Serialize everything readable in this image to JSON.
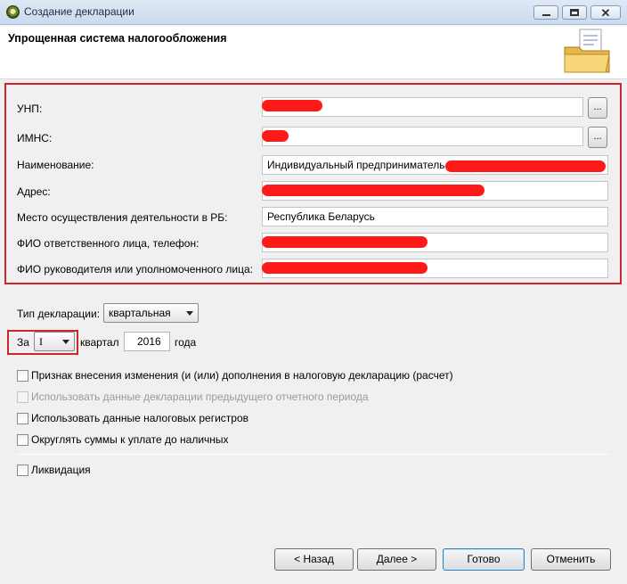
{
  "window": {
    "title": "Создание декларации"
  },
  "header": {
    "title": "Упрощенная система налогообложения"
  },
  "form": {
    "unp_label": "УНП:",
    "imns_label": "ИМНС:",
    "name_label": "Наименование:",
    "name_value": "Индивидуальный предприниматель",
    "address_label": "Адрес:",
    "place_label": "Место осуществления деятельности в РБ:",
    "place_value": "Республика Беларусь",
    "responsible_label": "ФИО ответственного лица, телефон:",
    "head_label": "ФИО руководителя или уполномоченного лица:",
    "browse_label": "..."
  },
  "declaration": {
    "type_label": "Тип декларации:",
    "type_value": "квартальная",
    "for_label": "За",
    "quarter_value": "I",
    "quarter_label": "квартал",
    "year_value": "2016",
    "year_label": "года"
  },
  "options": {
    "change_flag": "Признак внесения изменения (и (или) дополнения в налоговую декларацию (расчет)",
    "use_previous": "Использовать данные декларации предыдущего отчетного периода",
    "use_registers": "Использовать данные налоговых регистров",
    "round_sums": "Округлять суммы к уплате до наличных",
    "liquidation": "Ликвидация"
  },
  "buttons": {
    "back": "< Назад",
    "next": "Далее >",
    "finish": "Готово",
    "cancel": "Отменить"
  },
  "colors": {
    "highlight": "#d1242d",
    "redaction": "#ff1a1a"
  }
}
